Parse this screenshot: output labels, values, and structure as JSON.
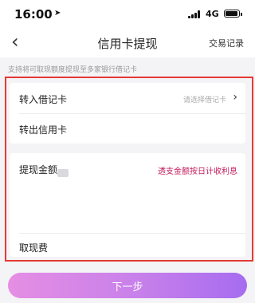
{
  "status_bar": {
    "time": "16:00",
    "network": "4G",
    "location_icon": "location-arrow-icon",
    "signal_icon": "signal-bars-icon",
    "battery_icon": "battery-icon"
  },
  "nav": {
    "back_icon": "chevron-left-icon",
    "title": "信用卡提现",
    "right_link": "交易记录"
  },
  "hint": "支持将可取现额度提现至多家银行借记卡",
  "transfer_card": {
    "debit_label": "转入借记卡",
    "debit_placeholder": "请选择借记卡",
    "credit_label": "转出信用卡"
  },
  "amount_card": {
    "amount_label": "提现金额",
    "interest_link": "透支金额按日计收利息",
    "fee_label": "取现费"
  },
  "next_button": "下一步",
  "colors": {
    "accent": "#c2185b",
    "highlight_border": "#e53935",
    "button_gradient_start": "#e58ee4",
    "button_gradient_end": "#a66cf0"
  }
}
